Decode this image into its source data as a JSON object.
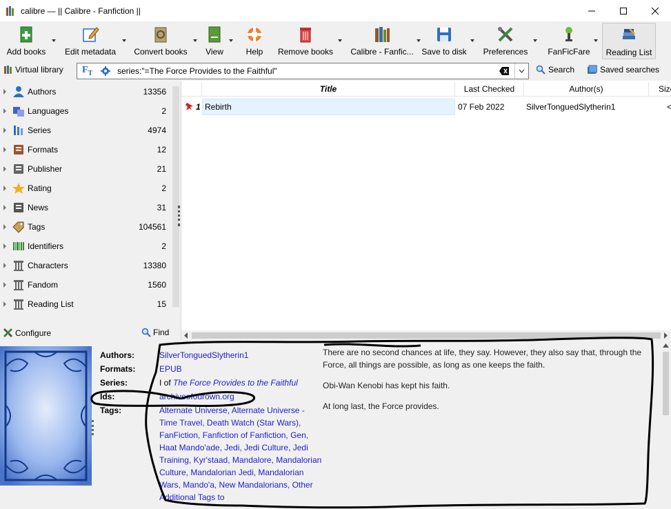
{
  "window": {
    "title": "calibre — || Calibre - Fanfiction ||"
  },
  "toolbar": {
    "buttons": [
      {
        "label": "Add books"
      },
      {
        "label": "Edit metadata"
      },
      {
        "label": "Convert books"
      },
      {
        "label": "View"
      },
      {
        "label": "Help"
      },
      {
        "label": "Remove books"
      },
      {
        "label": "Calibre - Fanfic..."
      },
      {
        "label": "Save to disk"
      },
      {
        "label": "Preferences"
      },
      {
        "label": "FanFicFare"
      },
      {
        "label": "Reading List"
      }
    ]
  },
  "searchbar": {
    "virtual_library": "Virtual library",
    "query": "series:\"=The Force Provides to the Faithful\"",
    "search_label": "Search",
    "saved_searches_label": "Saved searches"
  },
  "tag_browser": {
    "items": [
      {
        "name": "Authors",
        "count": "13356",
        "icon": "person-icon"
      },
      {
        "name": "Languages",
        "count": "2",
        "icon": "languages-icon"
      },
      {
        "name": "Series",
        "count": "4974",
        "icon": "series-icon"
      },
      {
        "name": "Formats",
        "count": "12",
        "icon": "formats-icon"
      },
      {
        "name": "Publisher",
        "count": "21",
        "icon": "publisher-icon"
      },
      {
        "name": "Rating",
        "count": "2",
        "icon": "star-icon"
      },
      {
        "name": "News",
        "count": "31",
        "icon": "news-icon"
      },
      {
        "name": "Tags",
        "count": "104561",
        "icon": "tag-icon"
      },
      {
        "name": "Identifiers",
        "count": "2",
        "icon": "barcode-icon"
      },
      {
        "name": "Characters",
        "count": "13380",
        "icon": "column-icon"
      },
      {
        "name": "Fandom",
        "count": "1560",
        "icon": "column-icon"
      },
      {
        "name": "Reading List",
        "count": "15",
        "icon": "column-icon"
      }
    ],
    "configure_label": "Configure",
    "find_label": "Find"
  },
  "book_list": {
    "columns": [
      "Title",
      "Last Checked",
      "Author(s)",
      "Size"
    ],
    "rows": [
      {
        "num": "1",
        "title": "Rebirth",
        "last_checked": "07 Feb 2022",
        "authors": "SilverTonguedSlytherin1",
        "size": "<"
      }
    ]
  },
  "details": {
    "labels": {
      "authors": "Authors:",
      "formats": "Formats:",
      "series": "Series:",
      "ids": "Ids:",
      "tags": "Tags:"
    },
    "authors": "SilverTonguedSlytherin1",
    "formats": "EPUB",
    "series_prefix": "I of",
    "series_name": "The Force Provides to the Faithful",
    "ids": "archiveofourown.org",
    "tags": "Alternate Universe, Alternate Universe - Time Travel, Death Watch (Star Wars), FanFiction, Fanfiction of Fanfiction, Gen, Haat Mando'ade, Jedi, Jedi Culture, Jedi Training, Kyr'staad, Mandalore, Mandalorian Culture, Mandalorian Jedi, Mandalorian Wars, Mando'a, New Mandalorians, Other Additional Tags to",
    "comments": [
      "There are no second chances at life, they say. However, they also say that, through the Force, all things are possible, as long as one keeps the faith.",
      "Obi-Wan Kenobi has kept his faith.",
      "At long last, the Force provides."
    ]
  },
  "colors": {
    "link": "#2020d0",
    "selection": "#e5f3ff",
    "chrome": "#f0f0f0"
  }
}
